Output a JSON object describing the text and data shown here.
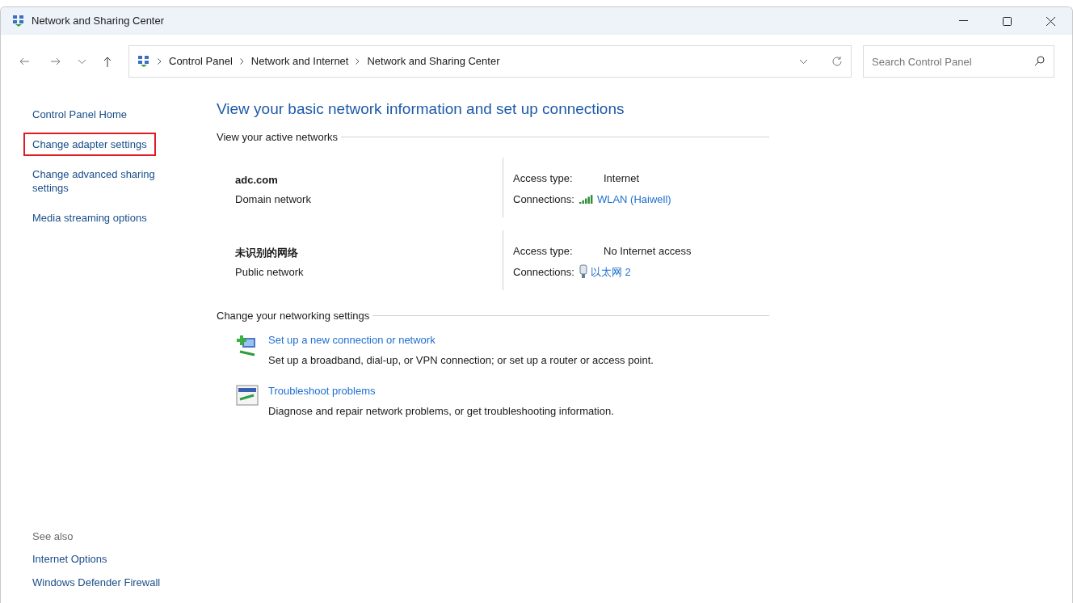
{
  "window": {
    "title": "Network and Sharing Center"
  },
  "address_bar": {
    "breadcrumbs": [
      "Control Panel",
      "Network and Internet",
      "Network and Sharing Center"
    ]
  },
  "search": {
    "placeholder": "Search Control Panel"
  },
  "sidebar": {
    "items": [
      {
        "label": "Control Panel Home",
        "highlighted": false
      },
      {
        "label": "Change adapter settings",
        "highlighted": true
      },
      {
        "label": "Change advanced sharing settings",
        "highlighted": false
      },
      {
        "label": "Media streaming options",
        "highlighted": false
      }
    ],
    "see_also": {
      "heading": "See also",
      "items": [
        "Internet Options",
        "Windows Defender Firewall"
      ]
    }
  },
  "main": {
    "title": "View your basic network information and set up connections",
    "active_networks": {
      "heading": "View your active networks",
      "networks": [
        {
          "name": "adc.com",
          "category": "Domain network",
          "access_label": "Access type:",
          "access": "Internet",
          "connections_label": "Connections:",
          "kind": "wifi",
          "connection": "WLAN (Haiwell)"
        },
        {
          "name": "未识别的网络",
          "category": "Public network",
          "access_label": "Access type:",
          "access": "No Internet access",
          "connections_label": "Connections:",
          "kind": "ethernet",
          "connection": "以太网 2"
        }
      ]
    },
    "settings": {
      "heading": "Change your networking settings",
      "tasks": [
        {
          "kind": "new-connection",
          "link": "Set up a new connection or network",
          "description": "Set up a broadband, dial-up, or VPN connection; or set up a router or access point."
        },
        {
          "kind": "troubleshoot",
          "link": "Troubleshoot problems",
          "description": "Diagnose and repair network problems, or get troubleshooting information."
        }
      ]
    }
  }
}
